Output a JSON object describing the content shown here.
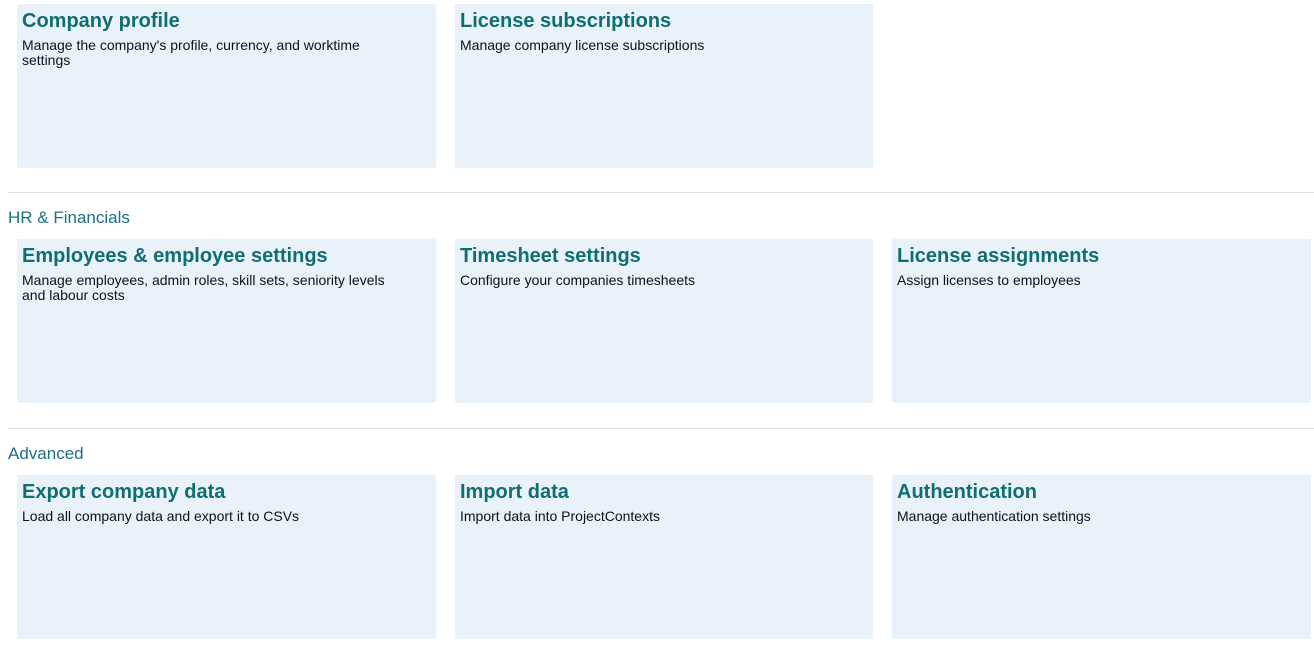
{
  "sections": [
    {
      "heading": "",
      "cards": [
        {
          "title": "Company profile",
          "description": "Manage the company's profile, currency, and worktime settings"
        },
        {
          "title": "License subscriptions",
          "description": "Manage company license subscriptions"
        }
      ]
    },
    {
      "heading": "HR & Financials",
      "cards": [
        {
          "title": "Employees & employee settings",
          "description": "Manage employees, admin roles, skill sets, seniority levels and labour costs"
        },
        {
          "title": "Timesheet settings",
          "description": "Configure your companies timesheets"
        },
        {
          "title": "License assignments",
          "description": "Assign licenses to employees"
        }
      ]
    },
    {
      "heading": "Advanced",
      "cards": [
        {
          "title": "Export company data",
          "description": "Load all company data and export it to CSVs"
        },
        {
          "title": "Import data",
          "description": "Import data into ProjectContexts"
        },
        {
          "title": "Authentication",
          "description": "Manage authentication settings"
        }
      ]
    }
  ],
  "colors": {
    "card_background": "#e9f2f9",
    "card_title": "#0f6e70",
    "section_heading": "#1e6f86",
    "divider": "#e2e2e2"
  }
}
